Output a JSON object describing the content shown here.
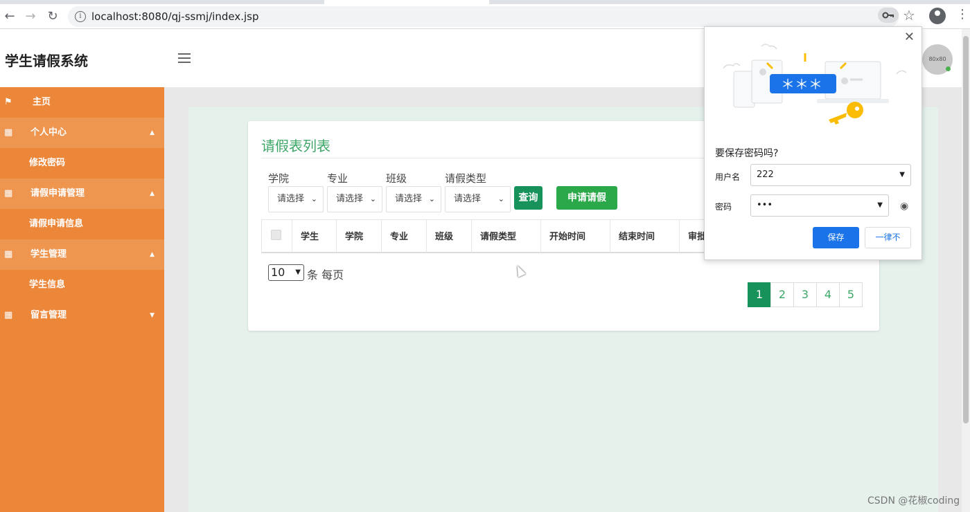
{
  "browser": {
    "url": "localhost:8080/qj-ssmj/index.jsp",
    "back_icon": "back-arrow-icon",
    "forward_icon": "forward-arrow-icon",
    "reload_icon": "reload-icon"
  },
  "header": {
    "app_title": "学生请假系统",
    "avatar_text": "80x80"
  },
  "sidebar": {
    "home": "主页",
    "groups": [
      {
        "label": "个人中心",
        "children": [
          "修改密码"
        ]
      },
      {
        "label": "请假申请管理",
        "children": [
          "请假申请信息"
        ]
      },
      {
        "label": "学生管理",
        "children": [
          "学生信息"
        ]
      },
      {
        "label": "留言管理",
        "children": []
      }
    ],
    "colors": {
      "bg": "#ec8639",
      "group_bg": "#ee9550"
    }
  },
  "main": {
    "title": "请假表列表",
    "filters": [
      {
        "label": "学院",
        "value": "请选择"
      },
      {
        "label": "专业",
        "value": "请选择"
      },
      {
        "label": "班级",
        "value": "请选择"
      },
      {
        "label": "请假类型",
        "value": "请选择"
      }
    ],
    "query_button": "查询",
    "apply_button": "申请请假",
    "columns": [
      "学生",
      "学院",
      "专业",
      "班级",
      "请假类型",
      "开始时间",
      "结束时间",
      "审批"
    ],
    "page_size": "10",
    "per_page_text": "条 每页",
    "pages": [
      "1",
      "2",
      "3",
      "4",
      "5"
    ],
    "current_page": "1",
    "colors": {
      "accent": "#3ea768",
      "primary": "#17925a"
    }
  },
  "password_popup": {
    "question": "要保存密码吗?",
    "username_label": "用户名",
    "username_value": "222",
    "password_label": "密码",
    "password_value": "•••",
    "save_button": "保存",
    "never_button": "一律不",
    "illus_stars": "＊＊＊"
  },
  "watermark": "CSDN @花椒coding"
}
